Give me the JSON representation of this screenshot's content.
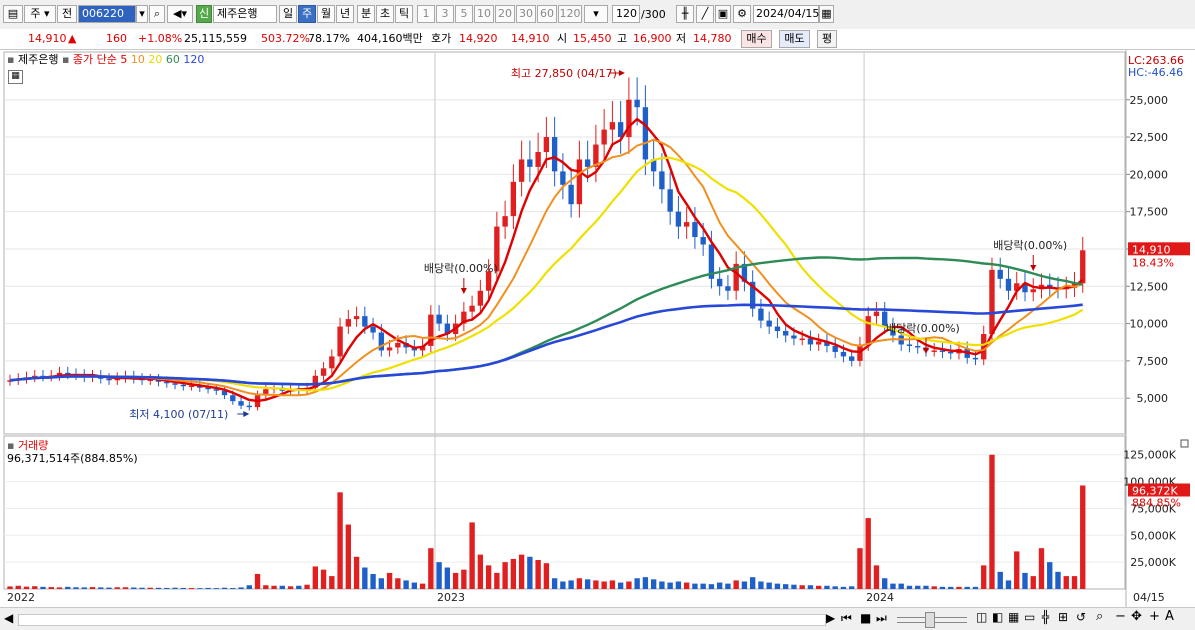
{
  "toolbar": {
    "type_label": "주",
    "prev_label": "전",
    "code": "006220",
    "new_badge": "신",
    "stock_name": "제주은행",
    "periods": [
      "일",
      "주",
      "월",
      "년",
      "분",
      "초",
      "틱"
    ],
    "selected_period": "주",
    "intervals": [
      "1",
      "3",
      "5",
      "10",
      "20",
      "30",
      "60",
      "120"
    ],
    "count": "120",
    "count_total": "/300",
    "date": "2024/04/15"
  },
  "quote": {
    "price": "14,910",
    "change": "160",
    "change_rate": "+1.08%",
    "volume": "25,115,559",
    "vol_ratio": "503.72%",
    "turnover": "78.17%",
    "amount": "404,160백만",
    "ask_label": "호가",
    "ask": "14,920",
    "bid": "14,910",
    "open_label": "시",
    "open": "15,450",
    "high_label": "고",
    "high": "16,900",
    "low_label": "저",
    "low": "14,780",
    "buy_label": "매수",
    "sell_label": "매도",
    "eval_label": "평"
  },
  "chart_data": [
    {
      "type": "candlestick",
      "legend": {
        "name": "제주은행",
        "price_type": "종가 단순",
        "ma_periods": [
          "5",
          "10",
          "20",
          "60",
          "120"
        ],
        "ma_colors": [
          "#e00000",
          "#f09020",
          "#f0e000",
          "#2e8b57",
          "#2848d8"
        ]
      },
      "y_ticks": [
        "25,000",
        "22,500",
        "20,000",
        "17,500",
        "15,000",
        "12,500",
        "10,000",
        "7,500",
        "5,000"
      ],
      "y_values": [
        25000,
        22500,
        20000,
        17500,
        15000,
        12500,
        10000,
        7500,
        5000
      ],
      "x_labels": [
        "2022",
        "2023",
        "2024",
        "04/15"
      ],
      "annotations": {
        "high": "최고 27,850 (04/17)",
        "low": "최저 4,100 (07/11)",
        "dividend": "배당락(0.00%)",
        "lc": "LC:263.66",
        "hc": "HC:-46.46",
        "last_price": "14,910",
        "last_rate": "18.43%"
      },
      "close": [
        6200,
        6300,
        6400,
        6500,
        6450,
        6500,
        6700,
        6600,
        6550,
        6400,
        6500,
        6300,
        6200,
        6350,
        6450,
        6300,
        6200,
        6250,
        6100,
        6000,
        5900,
        5800,
        5850,
        5700,
        5600,
        5500,
        5200,
        4800,
        4500,
        4400,
        5200,
        5600,
        5700,
        5500,
        5600,
        5500,
        5700,
        6500,
        7000,
        7800,
        9800,
        10300,
        10500,
        9800,
        9400,
        8200,
        8400,
        8700,
        8400,
        8200,
        8500,
        10600,
        10000,
        9300,
        10000,
        10800,
        11200,
        12200,
        13500,
        16500,
        17200,
        19500,
        21000,
        20500,
        21500,
        22500,
        20200,
        19300,
        18000,
        21000,
        20500,
        22000,
        23000,
        23500,
        22500,
        25000,
        24500,
        21000,
        20200,
        19000,
        17500,
        16500,
        16800,
        15800,
        15300,
        13000,
        12500,
        12200,
        14000,
        12800,
        11000,
        10200,
        9800,
        9500,
        9200,
        9000,
        9000,
        8600,
        8800,
        8500,
        8100,
        7800,
        7500,
        8600,
        10500,
        10800,
        9800,
        9200,
        8600,
        8500,
        8400,
        8200,
        8200,
        8100,
        8000,
        8300,
        7700,
        7600,
        9300,
        13600,
        13000,
        12200,
        12700,
        12100,
        12300,
        12600,
        12400,
        12300,
        12400,
        12700,
        14910
      ],
      "ma": {
        "5": "red line following close",
        "10": "orange",
        "20": "yellow",
        "60": "green",
        "120": "blue"
      }
    },
    {
      "type": "bar",
      "title": "거래량",
      "value_label": "96,371,514주(884.85%)",
      "y_ticks": [
        "125,000K",
        "100,000K",
        "75,000K",
        "50,000K",
        "25,000K"
      ],
      "y_values": [
        125000,
        100000,
        75000,
        50000,
        25000
      ],
      "last_value": "96,372K",
      "last_rate": "884.85%",
      "values": [
        2400,
        3000,
        2200,
        2600,
        2000,
        1800,
        1500,
        2000,
        1600,
        1500,
        1800,
        1500,
        1300,
        1600,
        1600,
        1400,
        1200,
        1200,
        1100,
        1000,
        1200,
        1000,
        900,
        800,
        1000,
        800,
        1200,
        900,
        1500,
        3500,
        14000,
        3500,
        3000,
        3000,
        2500,
        3000,
        4000,
        21000,
        18000,
        12000,
        90000,
        60000,
        30000,
        20000,
        14000,
        10000,
        15000,
        10000,
        8000,
        6000,
        5000,
        38000,
        25000,
        20000,
        15000,
        18000,
        62000,
        32000,
        22000,
        15000,
        25000,
        28000,
        32000,
        30000,
        27000,
        24000,
        10000,
        7000,
        8000,
        10000,
        9000,
        8000,
        7000,
        8000,
        6000,
        7000,
        10000,
        11000,
        9000,
        7000,
        6000,
        7000,
        6000,
        5000,
        5000,
        4500,
        6000,
        5000,
        8000,
        7000,
        11000,
        7000,
        6000,
        5000,
        4500,
        4000,
        3500,
        3500,
        3000,
        3000,
        2500,
        2000,
        2500,
        38000,
        66000,
        22000,
        10000,
        5000,
        5000,
        3000,
        3000,
        3000,
        2500,
        2000,
        2000,
        2000,
        2000,
        2000,
        22000,
        125000,
        16000,
        8000,
        35000,
        15000,
        12000,
        38000,
        25000,
        16000,
        12000,
        12000,
        96372
      ],
      "value_unit": "K"
    }
  ]
}
